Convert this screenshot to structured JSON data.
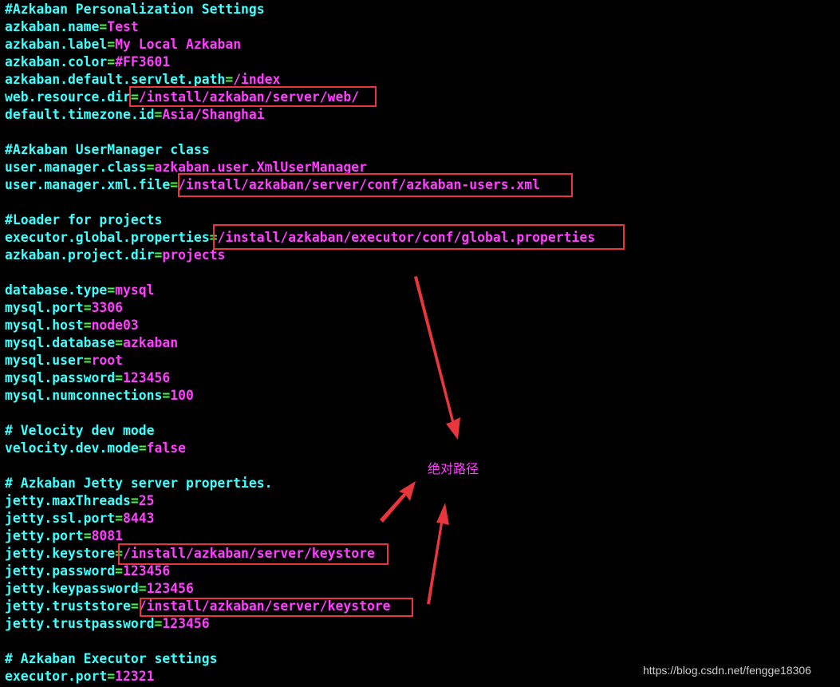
{
  "terminal": {
    "lines": [
      {
        "type": "comment",
        "text": "#Azkaban Personalization Settings"
      },
      {
        "type": "kv",
        "key": "azkaban.name",
        "value": "Test"
      },
      {
        "type": "kv",
        "key": "azkaban.label",
        "value": "My Local Azkaban"
      },
      {
        "type": "kv",
        "key": "azkaban.color",
        "value": "#FF3601"
      },
      {
        "type": "kv",
        "key": "azkaban.default.servlet.path",
        "value": "/index"
      },
      {
        "type": "kv",
        "key": "web.resource.dir",
        "value": "/install/azkaban/server/web/"
      },
      {
        "type": "kv",
        "key": "default.timezone.id",
        "value": "Asia/Shanghai"
      },
      {
        "type": "blank"
      },
      {
        "type": "comment",
        "text": "#Azkaban UserManager class"
      },
      {
        "type": "kv",
        "key": "user.manager.class",
        "value": "azkaban.user.XmlUserManager"
      },
      {
        "type": "kv",
        "key": "user.manager.xml.file",
        "value": "/install/azkaban/server/conf/azkaban-users.xml"
      },
      {
        "type": "blank"
      },
      {
        "type": "comment",
        "text": "#Loader for projects"
      },
      {
        "type": "kv",
        "key": "executor.global.properties",
        "value": "/install/azkaban/executor/conf/global.properties"
      },
      {
        "type": "kv",
        "key": "azkaban.project.dir",
        "value": "projects"
      },
      {
        "type": "blank"
      },
      {
        "type": "kv",
        "key": "database.type",
        "value": "mysql"
      },
      {
        "type": "kv",
        "key": "mysql.port",
        "value": "3306"
      },
      {
        "type": "kv",
        "key": "mysql.host",
        "value": "node03"
      },
      {
        "type": "kv",
        "key": "mysql.database",
        "value": "azkaban"
      },
      {
        "type": "kv",
        "key": "mysql.user",
        "value": "root"
      },
      {
        "type": "kv",
        "key": "mysql.password",
        "value": "123456"
      },
      {
        "type": "kv",
        "key": "mysql.numconnections",
        "value": "100"
      },
      {
        "type": "blank"
      },
      {
        "type": "comment",
        "text": "# Velocity dev mode"
      },
      {
        "type": "kv",
        "key": "velocity.dev.mode",
        "value": "false"
      },
      {
        "type": "blank"
      },
      {
        "type": "comment",
        "text": "# Azkaban Jetty server properties."
      },
      {
        "type": "kv",
        "key": "jetty.maxThreads",
        "value": "25"
      },
      {
        "type": "kv",
        "key": "jetty.ssl.port",
        "value": "8443"
      },
      {
        "type": "kv",
        "key": "jetty.port",
        "value": "8081"
      },
      {
        "type": "kv",
        "key": "jetty.keystore",
        "value": "/install/azkaban/server/keystore"
      },
      {
        "type": "kv",
        "key": "jetty.password",
        "value": "123456"
      },
      {
        "type": "kv",
        "key": "jetty.keypassword",
        "value": "123456"
      },
      {
        "type": "kv",
        "key": "jetty.truststore",
        "value": "/install/azkaban/server/keystore"
      },
      {
        "type": "kv",
        "key": "jetty.trustpassword",
        "value": "123456"
      },
      {
        "type": "blank"
      },
      {
        "type": "comment",
        "text": "# Azkaban Executor settings"
      },
      {
        "type": "kv",
        "key": "executor.port",
        "value": "12321"
      }
    ]
  },
  "annotation": {
    "label": "绝对路径",
    "color": "#E8363D",
    "text_color": "#FF40FF"
  },
  "watermark": {
    "text": "https://blog.csdn.net/fengge18306"
  },
  "colors": {
    "background": "#000000",
    "key": "#40FFFF",
    "equals": "#40FF40",
    "value": "#FF40FF",
    "highlight_box": "#E8363D"
  }
}
